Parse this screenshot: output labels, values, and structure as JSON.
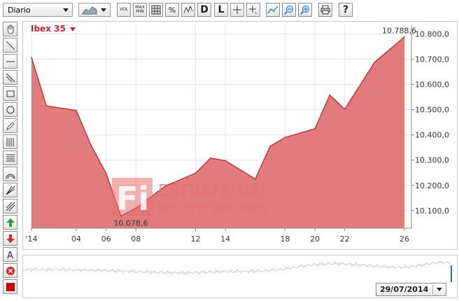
{
  "toolbar": {
    "period_select": "Diario",
    "chart_type_icon": "area-chart-icon",
    "vol_label": "VOL",
    "maxmin_label": "MAX\nMIN",
    "percent_label": "%",
    "d_label": "D",
    "l_label": "L",
    "help_label": "?"
  },
  "chart_data": {
    "type": "area",
    "title": "Ibex 35",
    "x": [
      "01",
      "02",
      "03",
      "04",
      "05",
      "06",
      "07",
      "08",
      "09",
      "10",
      "11",
      "12",
      "13",
      "14",
      "15",
      "16",
      "17",
      "18",
      "19",
      "20",
      "21",
      "22",
      "23",
      "24",
      "25",
      "26"
    ],
    "x_tick_labels": [
      "'14",
      "04",
      "06",
      "08",
      "12",
      "14",
      "18",
      "20",
      "22",
      "26"
    ],
    "tick_positions": [
      "01",
      "04",
      "06",
      "08",
      "12",
      "14",
      "18",
      "20",
      "22",
      "26"
    ],
    "values": [
      10708,
      10515,
      10497,
      10358,
      10248,
      10078.6,
      10110,
      10198,
      10248,
      10308,
      10298,
      10225,
      10355,
      10390,
      10425,
      10558,
      10502,
      10688,
      10788.6
    ],
    "value_x": [
      "01",
      "02",
      "04",
      "05",
      "06",
      "07",
      "08",
      "10",
      "12",
      "13",
      "14",
      "16",
      "17",
      "18",
      "20",
      "21",
      "22",
      "24",
      "26"
    ],
    "ylim": [
      10030,
      10835
    ],
    "y_ticks": [
      10100,
      10200,
      10300,
      10400,
      10500,
      10600,
      10700,
      10800
    ],
    "y_tick_labels": [
      "10.100,0",
      "10.200,0",
      "10.300,0",
      "10.400,0",
      "10.500,0",
      "10.600,0",
      "10.700,0",
      "10.800,0"
    ],
    "max_label": "10.788,6",
    "min_label": "10.078,6",
    "colors": {
      "fill": "#e27b7b",
      "line": "#c0272d",
      "grid": "#e3e3e3"
    }
  },
  "watermark": {
    "logo": "Fi",
    "line1": "ESTRATEGIAS",
    "line2": "de inversion.com"
  },
  "navigator": {
    "date": "29/07/2014"
  }
}
